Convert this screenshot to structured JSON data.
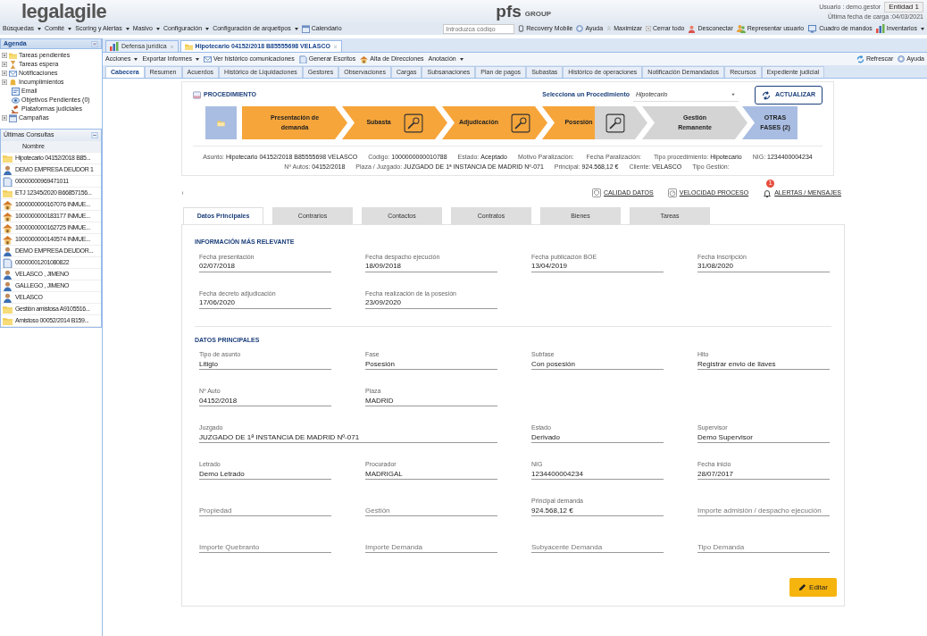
{
  "header": {
    "logo": "legalagile",
    "brand": "pfs",
    "brand_suffix": "GROUP",
    "user": "Usuario : demo.gestor",
    "entity": "Entidad 1",
    "last_load": "Última fecha de carga :04/03/2021"
  },
  "menu": [
    {
      "label": "Búsquedas",
      "has_menu": true
    },
    {
      "label": "Comité",
      "has_menu": true
    },
    {
      "label": "Scoring y Alertas",
      "has_menu": true
    },
    {
      "label": "Masivo",
      "has_menu": true
    },
    {
      "label": "Configuración",
      "has_menu": true
    },
    {
      "label": "Configuración de arquetipos",
      "has_menu": true
    },
    {
      "label": "Calendario",
      "has_menu": false
    }
  ],
  "code_field": {
    "placeholder": "Introduzca código"
  },
  "tools": [
    {
      "label": "Recovery Mobile",
      "has_menu": false
    },
    {
      "label": "Ayuda",
      "has_menu": false
    },
    {
      "label": "Maximizar",
      "has_menu": false
    },
    {
      "label": "Cerrar todo",
      "has_menu": false
    },
    {
      "label": "Desconectar",
      "has_menu": false
    },
    {
      "label": "Representar usuario",
      "has_menu": false
    },
    {
      "label": "Cuadro de mandos",
      "has_menu": false
    },
    {
      "label": "Inventarios",
      "has_menu": true
    }
  ],
  "agenda": {
    "title": "Agenda",
    "items": [
      {
        "label": "Tareas pendientes",
        "expandable": true
      },
      {
        "label": "Tareas espera",
        "expandable": true
      },
      {
        "label": "Notificaciones",
        "expandable": true
      },
      {
        "label": "Incumplimientos",
        "expandable": true
      },
      {
        "label": "Email",
        "expandable": false
      },
      {
        "label": "Objetivos Pendientes (0)",
        "expandable": false
      },
      {
        "label": "Plataformas judiciales",
        "expandable": false
      },
      {
        "label": "Campañas",
        "expandable": true
      }
    ]
  },
  "recent": {
    "title": "Últimas Consultas",
    "column": "Nombre",
    "rows": [
      {
        "kind": "case",
        "name": "Hipotecario 04152/2018 B85..."
      },
      {
        "kind": "person",
        "name": "DEMO EMPRESA DEUDOR 1"
      },
      {
        "kind": "document",
        "name": "00000000969471011"
      },
      {
        "kind": "case",
        "name": "ETJ 12345/2020 B66857156..."
      },
      {
        "kind": "property",
        "name": "1000000000167076 INMUE..."
      },
      {
        "kind": "property",
        "name": "1000000000183177 INMUE..."
      },
      {
        "kind": "property",
        "name": "1000000000162725 INMUE..."
      },
      {
        "kind": "property",
        "name": "1000000000140574 INMUE..."
      },
      {
        "kind": "person",
        "name": "DEMO EMPRESA DEUDOR..."
      },
      {
        "kind": "document",
        "name": "00000001201080822"
      },
      {
        "kind": "person",
        "name": "VELASCO , JIMENO"
      },
      {
        "kind": "person",
        "name": "GALLEGO , JIMENO"
      },
      {
        "kind": "person",
        "name": "VELASCO"
      },
      {
        "kind": "case",
        "name": "Gestión amistosa A9105516..."
      },
      {
        "kind": "case",
        "name": "Amistoso 00052/2014 B159..."
      }
    ]
  },
  "tabs": [
    {
      "label": "Defensa jurídica",
      "selected": false,
      "closable": true
    },
    {
      "label": "Hipotecario 04152/2018 B85555698 VELASCO",
      "selected": true,
      "closable": true
    }
  ],
  "actions": [
    {
      "label": "Acciones",
      "has_menu": true
    },
    {
      "label": "Exportar Informes",
      "has_menu": true
    },
    {
      "label": "Ver histórico comunicaciones",
      "has_menu": false
    },
    {
      "label": "Generar Escritos",
      "has_menu": false
    },
    {
      "label": "Alta de Direcciones",
      "has_menu": false
    },
    {
      "label": "Anotación",
      "has_menu": true
    }
  ],
  "actions_right": [
    "Refrescar",
    "Ayuda"
  ],
  "subtabs": [
    {
      "label": "Cabecera",
      "selected": true
    },
    {
      "label": "Resumen",
      "selected": false
    },
    {
      "label": "Acuerdos",
      "selected": false
    },
    {
      "label": "Histórico de Liquidaciones",
      "selected": false
    },
    {
      "label": "Gestores",
      "selected": false
    },
    {
      "label": "Observaciones",
      "selected": false
    },
    {
      "label": "Cargas",
      "selected": false
    },
    {
      "label": "Subsanaciones",
      "selected": false
    },
    {
      "label": "Plan de pagos",
      "selected": false
    },
    {
      "label": "Subastas",
      "selected": false
    },
    {
      "label": "Histórico de operaciones",
      "selected": false
    },
    {
      "label": "Notificación Demandados",
      "selected": false
    },
    {
      "label": "Recursos",
      "selected": false
    },
    {
      "label": "Expediente judicial",
      "selected": false
    }
  ],
  "procedure": {
    "title": "PROCEDIMIENTO",
    "select_label": "Selecciona un Procedimiento",
    "select_value": "Hipotecario",
    "refresh_button": "ACTUALIZAR",
    "phases": [
      {
        "kind": "start"
      },
      {
        "kind": "phase",
        "label": "Presentación de demanda",
        "completed": true,
        "current": false,
        "has_icon": false
      },
      {
        "kind": "phase",
        "label": "Subasta",
        "completed": true,
        "current": false,
        "has_icon": true
      },
      {
        "kind": "phase",
        "label": "Adjudicación",
        "completed": true,
        "current": false,
        "has_icon": true
      },
      {
        "kind": "phase",
        "label": "Posesión",
        "completed": false,
        "current": true,
        "has_icon": true
      },
      {
        "kind": "phase",
        "label": "Gestión Remanente",
        "completed": false,
        "current": false,
        "has_icon": false
      },
      {
        "kind": "more",
        "label": "OTRAS FASES (2)"
      }
    ],
    "summary": [
      [
        {
          "label": "Asunto:",
          "value": "Hipotecario 04152/2018 B85555698 VELASCO"
        },
        {
          "label": "Código:",
          "value": "1000000000010788"
        },
        {
          "label": "Estado:",
          "value": "Aceptado"
        },
        {
          "label": "Motivo Paralización:"
        },
        {
          "label": "Fecha Paralización:"
        },
        {
          "label": "Tipo procedimiento:",
          "value": "Hipotecario"
        },
        {
          "label": "NIG:",
          "value": "1234400004234"
        }
      ],
      [
        {
          "label": "Nº Autos:",
          "value": "04152/2018"
        },
        {
          "label": "Plaza / Juzgado:",
          "value": "JUZGADO DE 1ª INSTANCIA DE MADRID Nº-071"
        },
        {
          "label": "Principal:",
          "value": "924.568,12 €"
        },
        {
          "label": "Cliente:",
          "value": "VELASCO"
        },
        {
          "label": "Tipo Gestión:"
        }
      ]
    ]
  },
  "indicators": [
    {
      "label": "CALIDAD DATOS"
    },
    {
      "label": "VELOCIDAD PROCESO"
    },
    {
      "label": "ALERTAS / MENSAJES",
      "badge": "1"
    }
  ],
  "detail_tabs": [
    {
      "label": "Datos Principales",
      "selected": true
    },
    {
      "label": "Contrarios",
      "selected": false
    },
    {
      "label": "Contactos",
      "selected": false
    },
    {
      "label": "Contratos",
      "selected": false
    },
    {
      "label": "Bienes",
      "selected": false
    },
    {
      "label": "Tareas",
      "selected": false
    }
  ],
  "sections": [
    {
      "title": "INFORMACIÓN MÁS RELEVANTE",
      "rows": [
        [
          {
            "label": "Fecha presentación",
            "value": "02/07/2018"
          },
          {
            "label": "Fecha despacho ejecución",
            "value": "18/09/2018"
          },
          {
            "label": "Fecha publicación BOE",
            "value": "13/04/2019"
          },
          {
            "label": "Fecha Inscripción",
            "value": "31/08/2020"
          }
        ],
        [
          {
            "label": "Fecha decreto adjudicación",
            "value": "17/06/2020"
          },
          {
            "label": "Fecha realización de la posesión",
            "value": "23/09/2020"
          }
        ]
      ]
    },
    {
      "title": "DATOS PRINCIPALES",
      "rows": [
        [
          {
            "label": "Tipo de asunto",
            "value": "Litigio"
          },
          {
            "label": "Fase",
            "value": "Posesión"
          },
          {
            "label": "Subfase",
            "value": "Con posesión"
          },
          {
            "label": "Hito",
            "value": "Registrar envio de llaves"
          }
        ],
        [
          {
            "label": "Nº Auto",
            "value": "04152/2018"
          },
          {
            "label": "Plaza",
            "value": "MADRID"
          }
        ],
        [
          {
            "label": "Juzgado",
            "value": "JUZGADO DE 1ª INSTANCIA DE MADRID Nº-071"
          },
          "",
          {
            "label": "Estado",
            "value": "Derivado"
          },
          {
            "label": "Supervisor",
            "value": "Demo Supervisor"
          }
        ],
        [
          {
            "label": "Letrado",
            "value": "Demo Letrado"
          },
          {
            "label": "Procurador",
            "value": "MADRIGAL"
          },
          {
            "label": "NIG",
            "value": "1234400004234"
          },
          {
            "label": "Fecha inicio",
            "value": "28/07/2017"
          }
        ],
        [
          {
            "placeholder": "Propiedad"
          },
          {
            "placeholder": "Gestión"
          },
          {
            "label": "Principal demanda",
            "value": "924.568,12 €"
          },
          {
            "placeholder": "Importe admisión / despacho ejecución"
          }
        ],
        [
          {
            "placeholder": "Importe Quebranto"
          },
          {
            "placeholder": "Importe Demanda"
          },
          {
            "placeholder": "Subyacente Demanda"
          },
          {
            "placeholder": "Tipo Demanda"
          }
        ]
      ]
    }
  ],
  "edit_button": "Editar"
}
